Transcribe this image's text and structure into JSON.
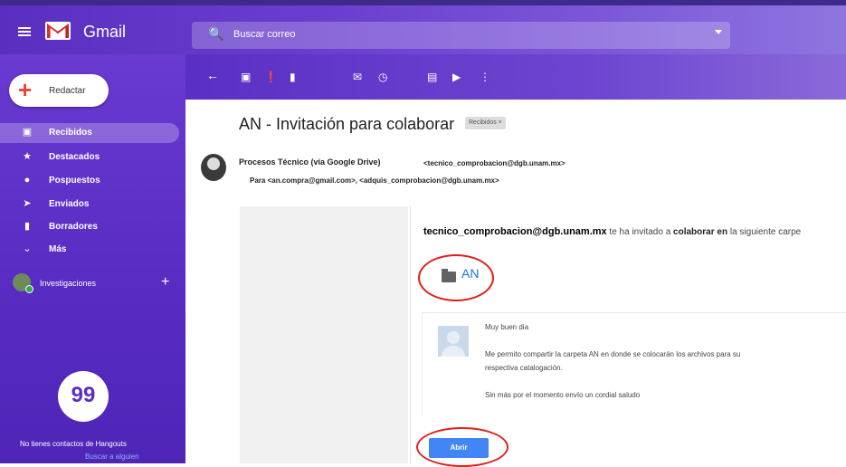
{
  "app": {
    "name": "Gmail"
  },
  "search": {
    "placeholder": "Buscar correo"
  },
  "compose": {
    "label": "Redactar"
  },
  "sidebar": {
    "items": [
      {
        "label": "Recibidos",
        "icon": "inbox-icon",
        "active": true
      },
      {
        "label": "Destacados",
        "icon": "star-icon"
      },
      {
        "label": "Pospuestos",
        "icon": "clock-icon"
      },
      {
        "label": "Enviados",
        "icon": "send-icon"
      },
      {
        "label": "Borradores",
        "icon": "draft-icon"
      },
      {
        "label": "Más",
        "icon": "chevron-down-icon"
      }
    ],
    "hangouts_user": "Investigaciones",
    "hangouts_text": "No tienes contactos de Hangouts",
    "hangouts_link": "Buscar a alguien"
  },
  "toolbar": {
    "icons": [
      "back-icon",
      "archive-icon",
      "report-spam-icon",
      "delete-icon",
      "mark-unread-icon",
      "snooze-icon",
      "move-to-icon",
      "labels-icon",
      "more-icon"
    ]
  },
  "email": {
    "subject": "AN - Invitación para colaborar",
    "label_chip": "Recibidos ×",
    "sender_name": "Procesos Técnico (vía Google Drive)",
    "sender_email": "<tecnico_comprobacion@dgb.unam.mx>",
    "to_line": "Para <an.compra@gmail.com>, <adquis_comprobacion@dgb.unam.mx>",
    "invite_sender": "tecnico_comprobacion@dgb.unam.mx",
    "invite_text_a": " te ha invitado a ",
    "invite_text_bold": "colaborar en",
    "invite_text_b": " la siguiente carpe",
    "folder_name": "AN",
    "message_lines": [
      "Muy buen dia",
      "Me permito compartir la carpeta AN en donde se colocarán los archivos para su",
      "respectiva catalogación.",
      "Sin más por el momento envío un cordial saludo"
    ],
    "open_button": "Abrir"
  },
  "colors": {
    "accent": "#5a2dc4",
    "annotation": "#e0201c",
    "link": "#1a73e8"
  }
}
